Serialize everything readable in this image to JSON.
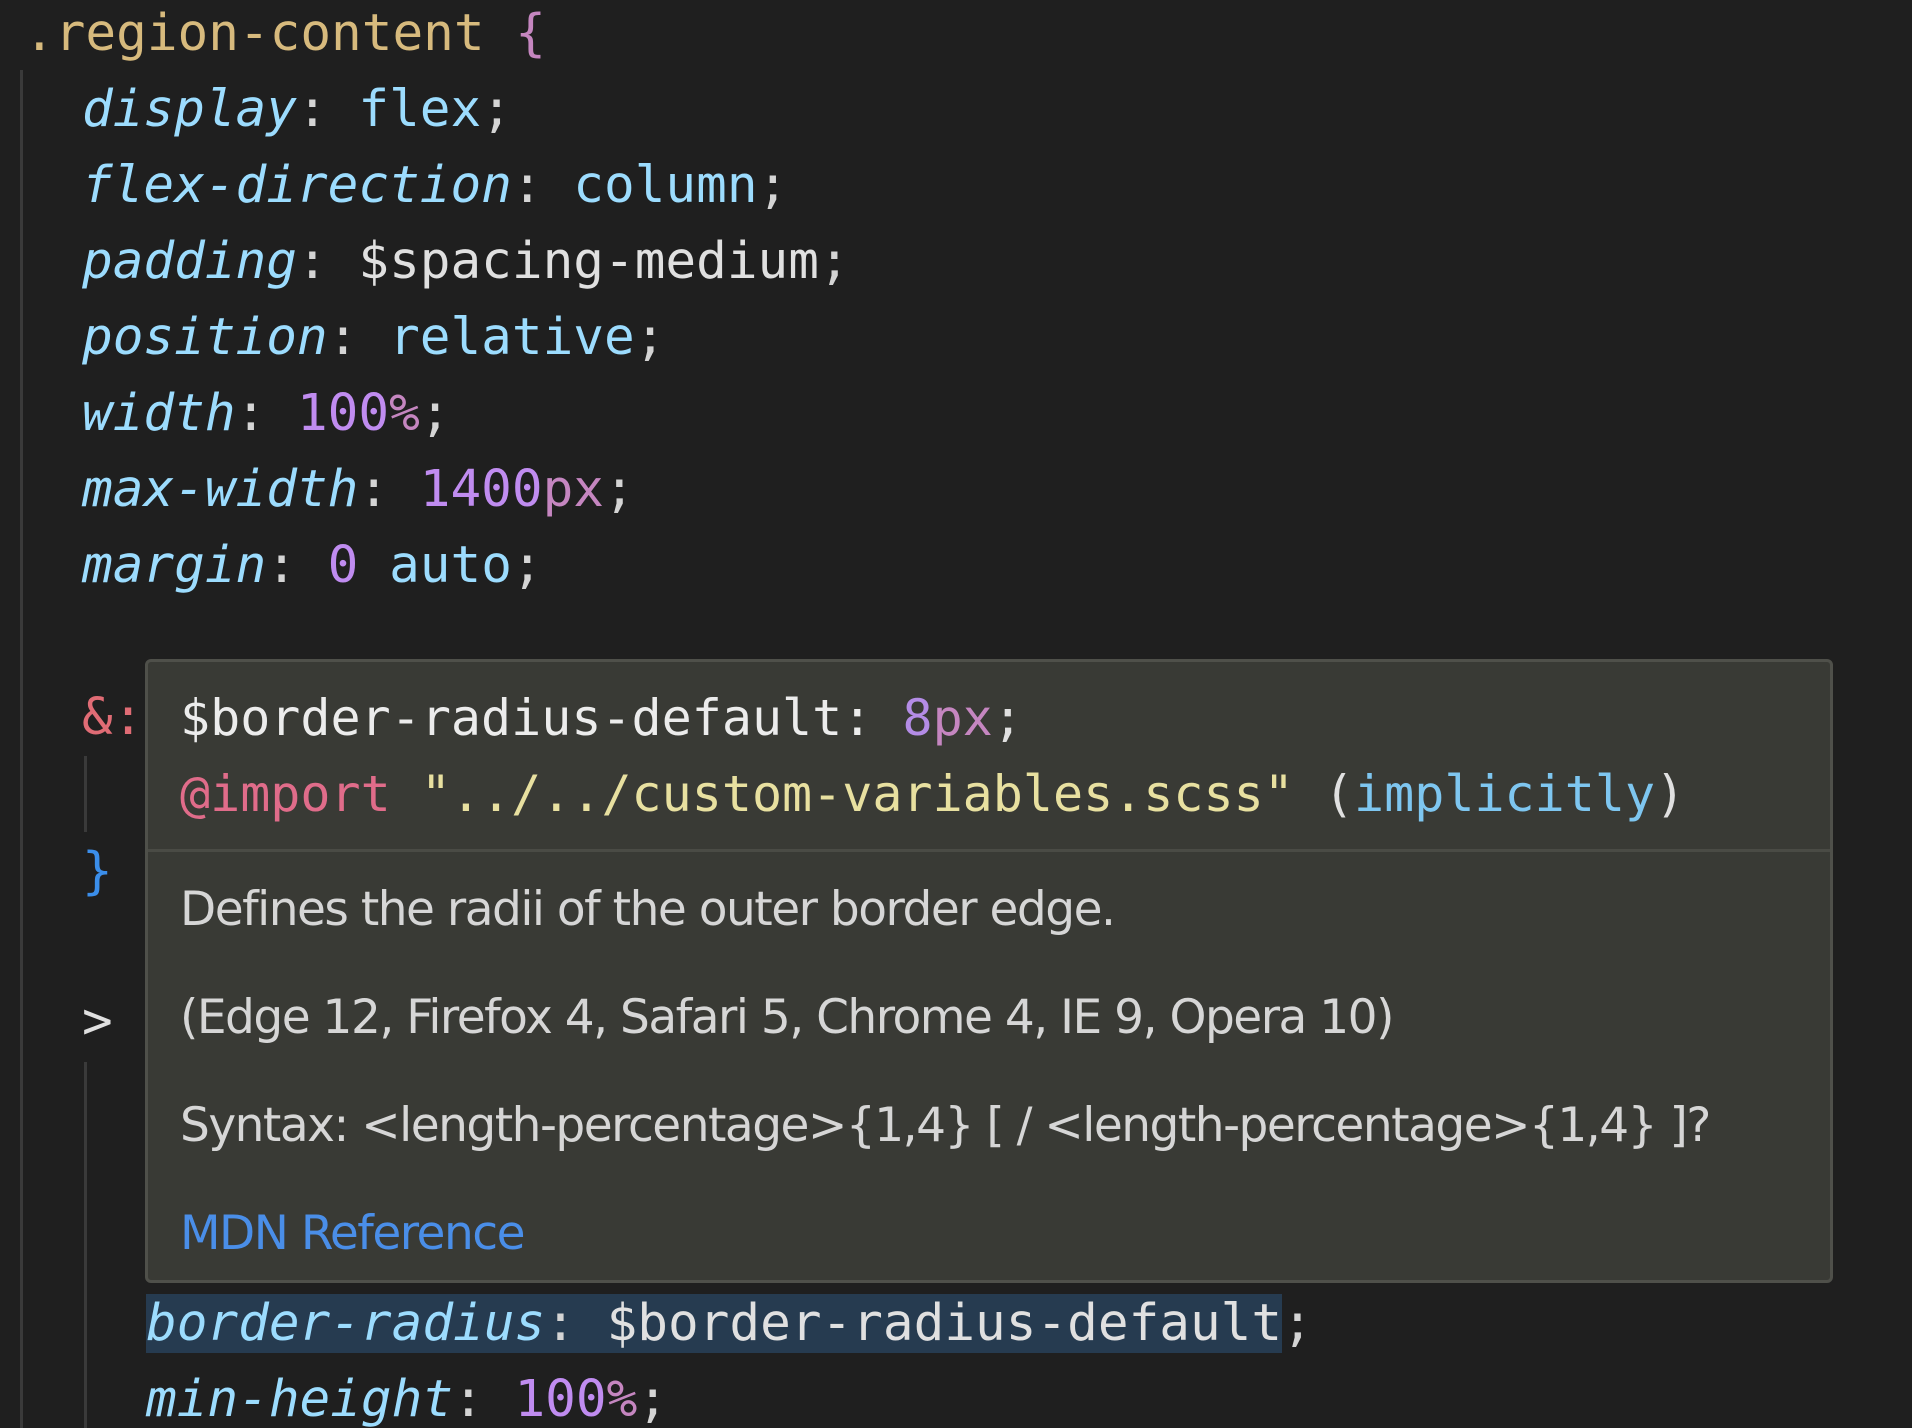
{
  "editor": {
    "selector": ".region-content",
    "open_brace": "{",
    "declarations": [
      {
        "property": "display",
        "value": "flex"
      },
      {
        "property": "flex-direction",
        "value": "column"
      },
      {
        "property": "padding",
        "value": "$spacing-medium"
      },
      {
        "property": "position",
        "value": "relative"
      },
      {
        "property": "width",
        "number": "100",
        "unit": "%"
      },
      {
        "property": "max-width",
        "number": "1400",
        "unit": "px"
      },
      {
        "property": "margin",
        "number": "0",
        "rest": "auto"
      }
    ],
    "nested_amp": "&:",
    "nested_close": "}",
    "child_chevron": ">",
    "lower_declarations": [
      {
        "property": "border-radius",
        "value": "$border-radius-default"
      },
      {
        "property": "min-height",
        "number": "100",
        "unit": "%"
      }
    ]
  },
  "hover": {
    "var_name": "$border-radius-default:",
    "var_number": "8",
    "var_unit": "px",
    "var_semicolon": ";",
    "import_keyword": "@import",
    "import_path": "\"../../custom-variables.scss\"",
    "import_note_open": " (",
    "import_note": "implicitly",
    "import_note_close": ")",
    "description": "Defines the radii of the outer border edge.",
    "compatibility": "(Edge 12, Firefox 4, Safari 5, Chrome 4, IE 9, Opera 10)",
    "syntax": "Syntax: <length-percentage>{1,4} [ / <length-percentage>{1,4} ]?",
    "link_label": "MDN Reference"
  },
  "colors": {
    "background": "#1f1f1f",
    "hover_background": "#393a35",
    "link": "#4a8ee8"
  }
}
